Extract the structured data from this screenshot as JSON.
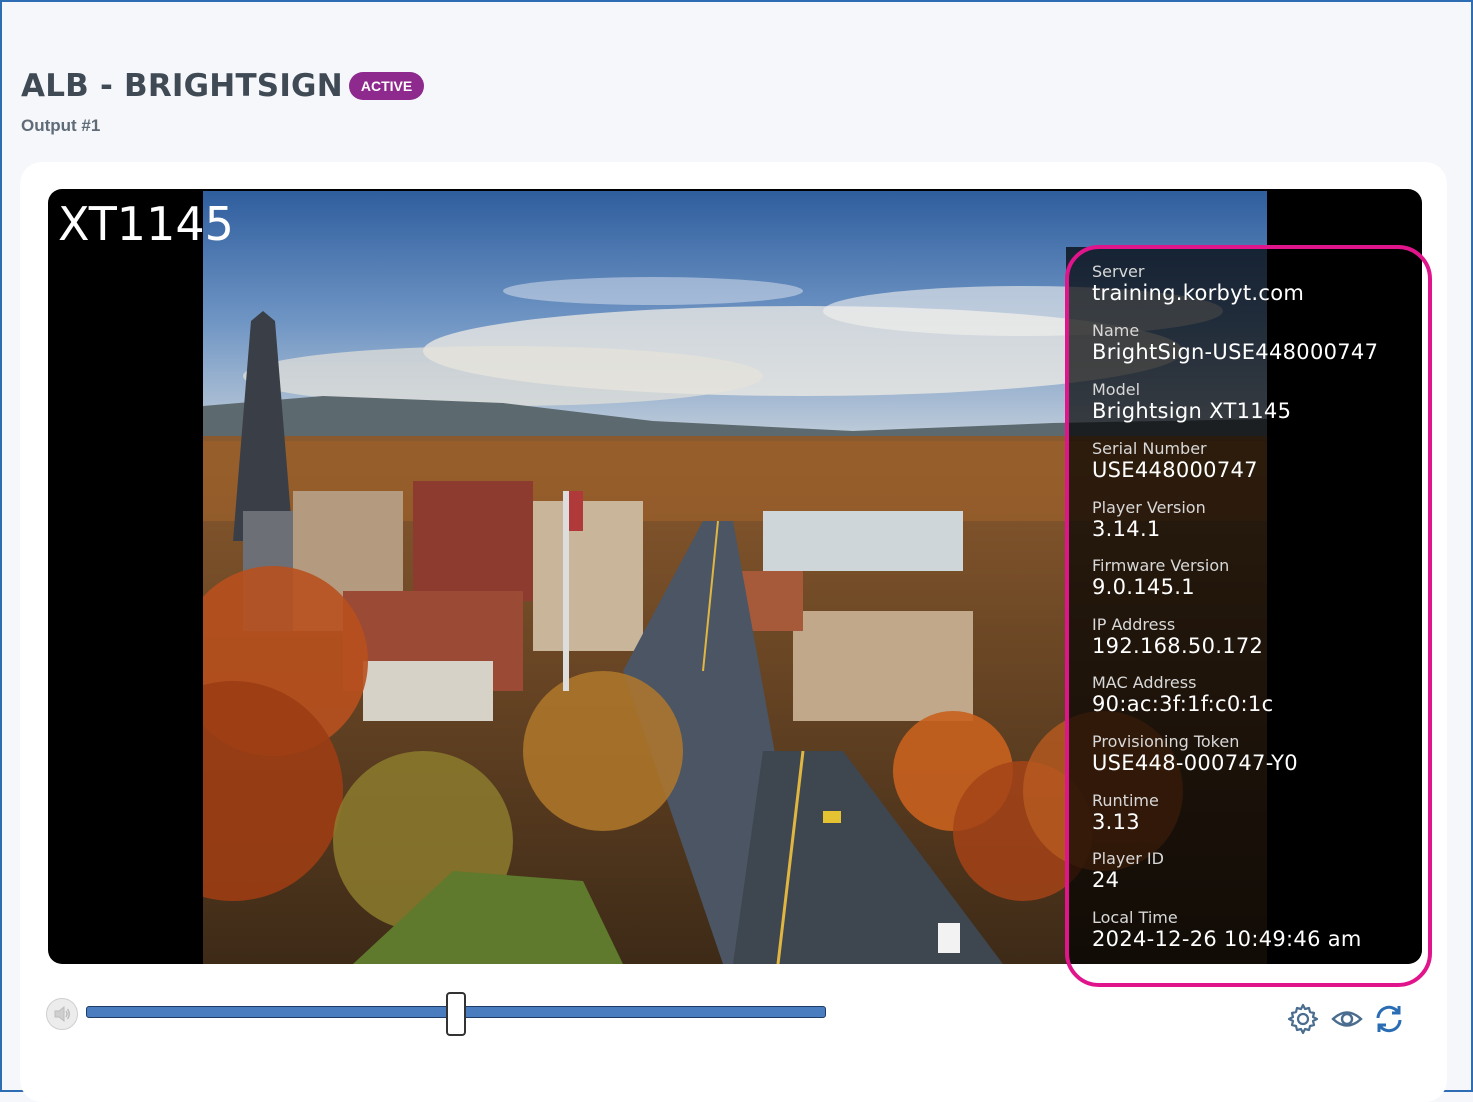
{
  "header": {
    "title": "ALB - BRIGHTSIGN",
    "status_badge": "ACTIVE",
    "subtitle": "Output #1"
  },
  "preview": {
    "device_label": "XT1145",
    "info": [
      {
        "label": "Server",
        "value": "training.korbyt.com"
      },
      {
        "label": "Name",
        "value": "BrightSign-USE448000747"
      },
      {
        "label": "Model",
        "value": "Brightsign XT1145"
      },
      {
        "label": "Serial Number",
        "value": "USE448000747"
      },
      {
        "label": "Player Version",
        "value": "3.14.1"
      },
      {
        "label": "Firmware Version",
        "value": "9.0.145.1"
      },
      {
        "label": "IP Address",
        "value": "192.168.50.172"
      },
      {
        "label": "MAC Address",
        "value": "90:ac:3f:1f:c0:1c"
      },
      {
        "label": "Provisioning Token",
        "value": "USE448-000747-Y0"
      },
      {
        "label": "Runtime",
        "value": "3.13"
      },
      {
        "label": "Player ID",
        "value": "24"
      },
      {
        "label": "Local Time",
        "value": "2024-12-26 10:49:46 am"
      }
    ]
  },
  "controls": {
    "volume_level": 0.5,
    "icons": [
      "volume-icon",
      "gear-icon",
      "eye-icon",
      "refresh-icon"
    ]
  },
  "colors": {
    "badge": "#8e2a8e",
    "highlight": "#e0158c",
    "slider": "#4a7dbf",
    "icon": "#4a6c8e",
    "refresh": "#2a6db5"
  }
}
